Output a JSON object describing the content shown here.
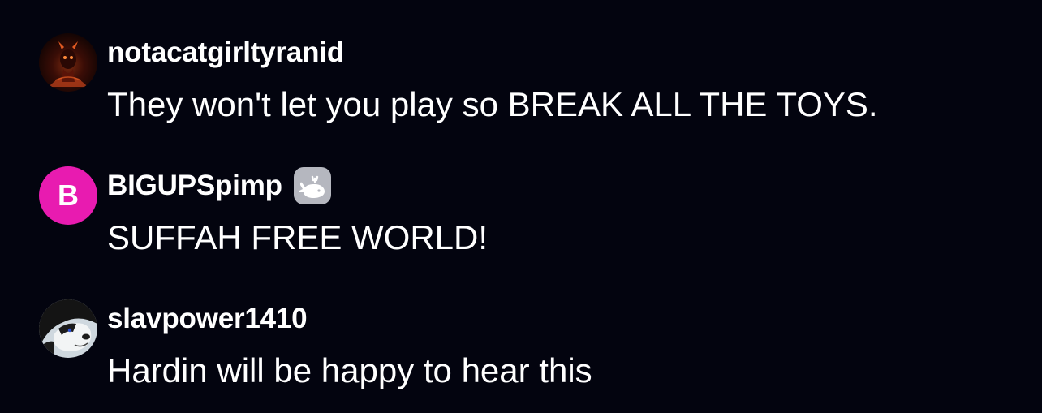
{
  "comments": [
    {
      "username": "notacatgirltyranid",
      "avatar": "demon-portrait-avatar",
      "message": "They won't let you play so BREAK ALL THE TOYS."
    },
    {
      "username": "BIGUPSpimp",
      "avatar_letter": "B",
      "avatar_color": "#e81bb0",
      "badge": "whale-icon",
      "message": "SUFFAH FREE WORLD!"
    },
    {
      "username": "slavpower1410",
      "avatar": "dog-portrait-avatar",
      "message": "Hardin will be happy to hear this"
    }
  ],
  "colors": {
    "background": "#03040f",
    "text": "#ffffff",
    "badge": "#b5b7bf"
  }
}
